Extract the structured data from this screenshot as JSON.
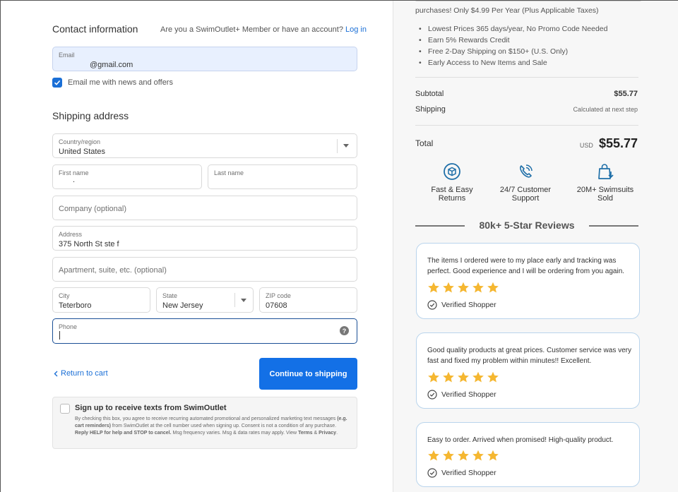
{
  "contact": {
    "heading": "Contact information",
    "member_prompt": "Are you a SwimOutlet+ Member or have an account?",
    "login_link": "Log in",
    "email_label": "Email",
    "email_value": "@gmail.com",
    "news_label": "Email me with news and offers"
  },
  "shipping": {
    "heading": "Shipping address",
    "country_label": "Country/region",
    "country_value": "United States",
    "first_name_label": "First name",
    "first_name_value": ".",
    "last_name_label": "Last name",
    "company_placeholder": "Company (optional)",
    "address_label": "Address",
    "address_value": "375 North St ste f",
    "apartment_placeholder": "Apartment, suite, etc. (optional)",
    "city_label": "City",
    "city_value": "Teterboro",
    "state_label": "State",
    "state_value": "New Jersey",
    "zip_label": "ZIP code",
    "zip_value": "07608",
    "phone_label": "Phone",
    "phone_help": "?"
  },
  "actions": {
    "return_label": "Return to cart",
    "continue_label": "Continue to shipping"
  },
  "sms": {
    "heading": "Sign up to receive texts from SwimOutlet",
    "p1": "By checking this box, you agree to receive recurring automated promotional and personalized marketing text messages",
    "p2": "(e.g. cart reminders)",
    "p3": "from SwimOutlet at the cell number used when signing up. Consent is not a condition of any purchase.",
    "p4": "Reply HELP for help and STOP to cancel.",
    "p5": "Msg frequency varies. Msg & data rates may apply. View",
    "terms": "Terms",
    "amp": "&",
    "privacy": "Privacy",
    "period": "."
  },
  "summary": {
    "promo_line": "purchases! Only $4.99 Per Year (Plus Applicable Taxes)",
    "benefits": [
      "Lowest Prices 365 days/year, No Promo Code Needed",
      "Earn 5% Rewards Credit",
      "Free 2-Day Shipping on $150+ (U.S. Only)",
      "Early Access to New Items and Sale"
    ],
    "subtotal_label": "Subtotal",
    "subtotal_value": "$55.77",
    "shipping_label": "Shipping",
    "shipping_value": "Calculated at next step",
    "total_label": "Total",
    "currency": "USD",
    "total_value": "$55.77"
  },
  "features": [
    {
      "line1": "Fast & Easy",
      "line2": "Returns",
      "icon": "box-return-icon"
    },
    {
      "line1": "24/7 Customer",
      "line2": "Support",
      "icon": "phone-icon"
    },
    {
      "line1": "20M+ Swimsuits",
      "line2": "Sold",
      "icon": "shopping-bag-icon"
    }
  ],
  "reviews_heading": "80k+ 5-Star Reviews",
  "reviews": [
    {
      "text": "The items I ordered were to my place early and tracking was perfect. Good experience and I will be ordering from you again.",
      "stars": 5,
      "verified": "Verified Shopper"
    },
    {
      "text": "Good quality products at great prices. Customer service was very fast and fixed my problem within minutes!! Excellent.",
      "stars": 5,
      "verified": "Verified Shopper"
    },
    {
      "text": "Easy to order. Arrived when promised! High-quality product.",
      "stars": 5,
      "verified": "Verified Shopper"
    }
  ],
  "colors": {
    "accent": "#1370e6",
    "link": "#1a6fd6",
    "star": "#f5b731",
    "review_border": "#b9d4ec",
    "icon_teal": "#1f6fa8"
  }
}
